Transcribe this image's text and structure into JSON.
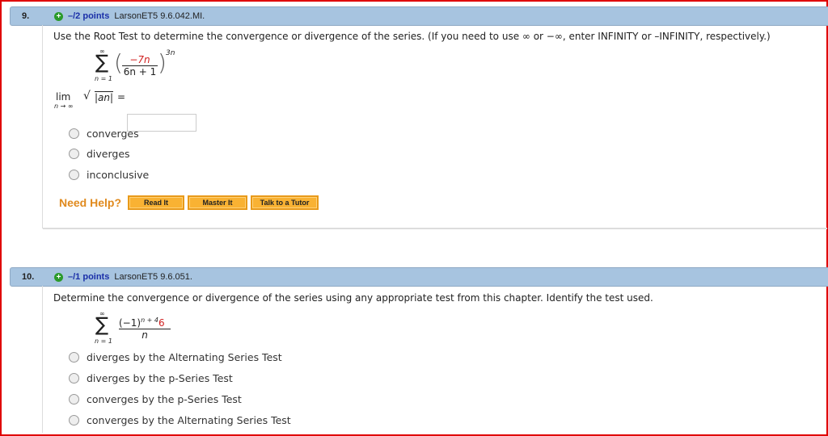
{
  "q9": {
    "number": "9.",
    "points": "–/2 points",
    "source": "LarsonET5 9.6.042.MI.",
    "prompt": "Use the Root Test to determine the convergence or divergence of the series. (If you need to use ∞ or −∞, enter INFINITY or –INFINITY, respectively.)",
    "sum_upper": "∞",
    "sum_lower": "n = 1",
    "numerator": "−7n",
    "denominator": "6n + 1",
    "exponent": "3n",
    "lim_label": "lim",
    "lim_sub": "n → ∞",
    "root_expr": "|an|",
    "equals": "=",
    "answer_value": "",
    "options": [
      "converges",
      "diverges",
      "inconclusive"
    ],
    "help_label": "Need Help?",
    "buttons": [
      "Read It",
      "Master It",
      "Talk to a Tutor"
    ]
  },
  "q10": {
    "number": "10.",
    "points": "–/1 points",
    "source": "LarsonET5 9.6.051.",
    "prompt": "Determine the convergence or divergence of the series using any appropriate test from this chapter. Identify the test used.",
    "sum_upper": "∞",
    "sum_lower": "n = 1",
    "numerator_base": "(−1)",
    "numerator_exp": "n + 4",
    "numerator_coef": "6",
    "denominator": "n",
    "options": [
      "diverges by the Alternating Series Test",
      "diverges by the p-Series Test",
      "converges by the p-Series Test",
      "converges by the Alternating Series Test"
    ]
  }
}
